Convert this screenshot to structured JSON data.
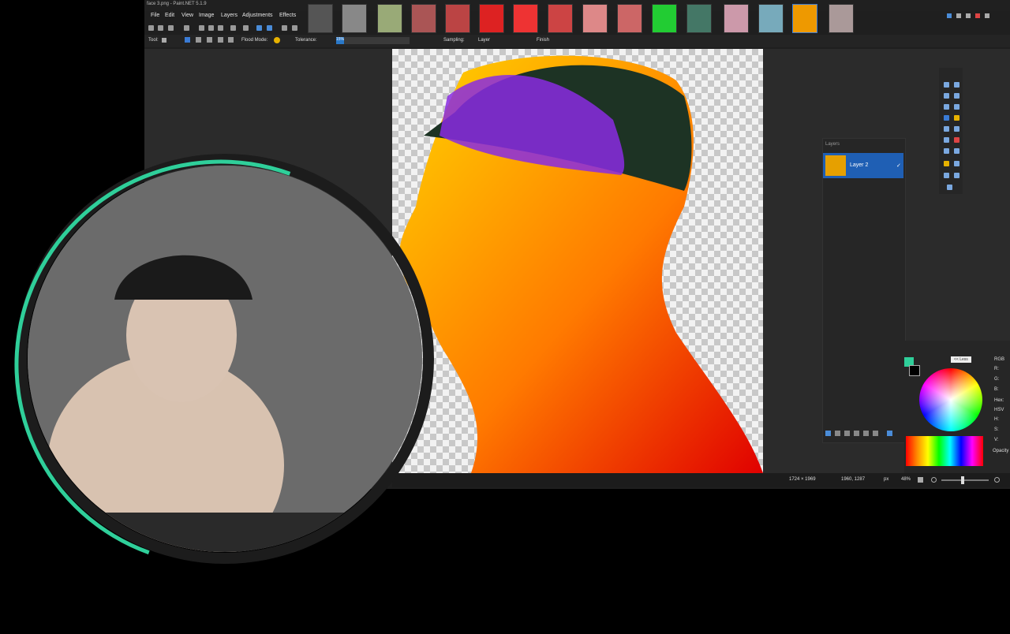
{
  "app": {
    "title": "face 3.png - Paint.NET 5.1.9"
  },
  "menu": [
    "File",
    "Edit",
    "View",
    "Image",
    "Layers",
    "Adjustments",
    "Effects"
  ],
  "toolbar": {
    "tool_label": "Tool:",
    "flood_mode_label": "Flood Mode:",
    "tolerance_label": "Tolerance:",
    "tolerance_value": "15%",
    "sampling_label": "Sampling:",
    "sampling_value": "Layer",
    "finish_label": "Finish"
  },
  "layers_panel": {
    "title": "Layers",
    "layer_name": "Layer 2"
  },
  "status": {
    "image_size": "1724 × 1969",
    "cursor_pos": "1960, 1287",
    "unit": "px",
    "zoom": "48%"
  },
  "colors_panel": {
    "less_button": "<< Less",
    "mode": "RGB",
    "fields": [
      "R:",
      "G:",
      "B:",
      "Hex:",
      "HSV",
      "H:",
      "S:",
      "V:",
      "Opacity"
    ]
  },
  "colors": {
    "accent": "#2fcf9a",
    "selection": "#1f5fb4"
  }
}
